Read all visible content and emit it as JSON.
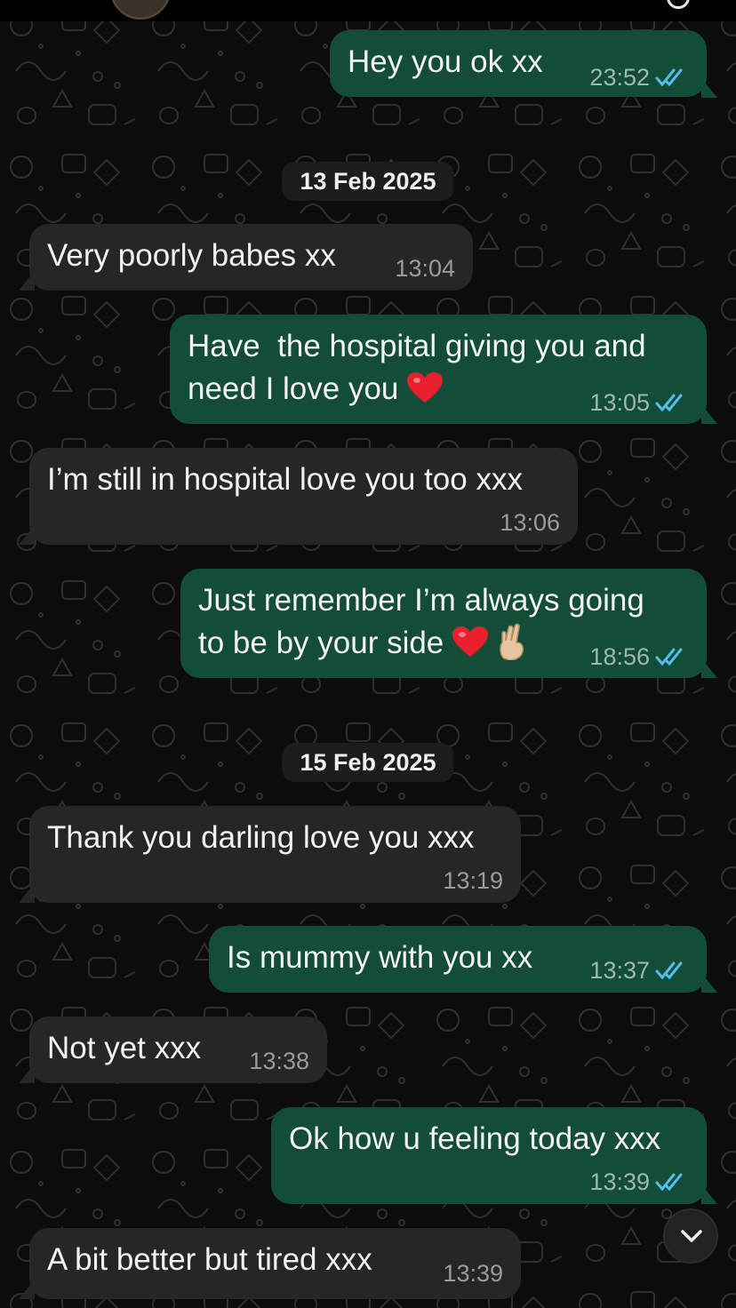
{
  "chat": {
    "messages": [
      {
        "dir": "out",
        "text": "Hey you ok xx",
        "time": "23:52",
        "read": true
      },
      {
        "dir": "in",
        "text": "Very poorly babes xx",
        "time": "13:04"
      },
      {
        "dir": "out",
        "text_line1": "Have  the hospital giving you and",
        "text_line2": "need I love you",
        "time": "13:05",
        "read": true
      },
      {
        "dir": "in",
        "text": "I’m still in hospital love you too xxx",
        "time": "13:06"
      },
      {
        "dir": "out",
        "text_line1": "Just remember I’m always going",
        "text_line2": "to be by your side",
        "time": "18:56",
        "read": true
      },
      {
        "dir": "in",
        "text": "Thank you darling love you xxx",
        "time": "13:19"
      },
      {
        "dir": "out",
        "text": "Is mummy with you xx",
        "time": "13:37",
        "read": true
      },
      {
        "dir": "in",
        "text": "Not yet xxx",
        "time": "13:38"
      },
      {
        "dir": "out",
        "text": "Ok how u feeling today xxx",
        "time": "13:39",
        "read": true
      },
      {
        "dir": "in",
        "text": "A bit better but tired xxx",
        "time": "13:39"
      }
    ],
    "date_separators": [
      "13 Feb 2025",
      "15 Feb 2025"
    ]
  },
  "colors": {
    "outgoing_bubble": "#134d37",
    "incoming_bubble": "#262626",
    "read_ticks": "#53bdeb",
    "background": "#0c0c0c"
  },
  "icons": {
    "read_receipt": "double-check-icon",
    "scroll_down": "chevron-down-icon",
    "emoji_heart": "red-heart-emoji",
    "emoji_fingers": "crossed-fingers-emoji"
  }
}
